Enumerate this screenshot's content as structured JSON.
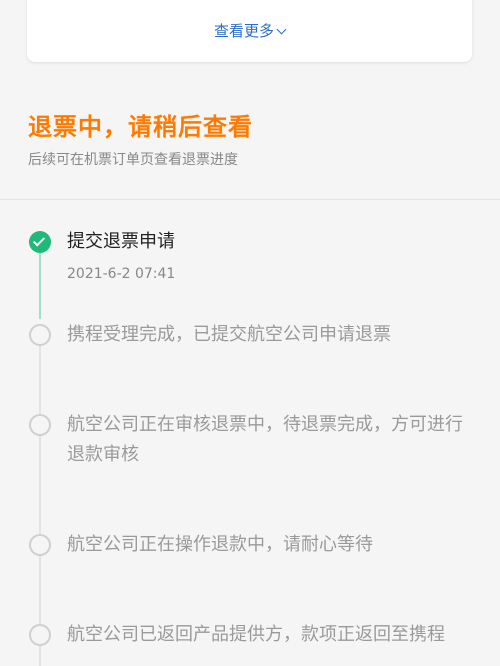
{
  "card": {
    "see_more_label": "查看更多"
  },
  "status": {
    "title": "退票中，请稍后查看",
    "subtitle": "后续可在机票订单页查看退票进度"
  },
  "steps": [
    {
      "text": "提交退票申请",
      "time": "2021-6-2 07:41",
      "done": true
    },
    {
      "text": "携程受理完成，已提交航空公司申请退票",
      "done": false
    },
    {
      "text": "航空公司正在审核退票中，待退票完成，方可进行退款审核",
      "done": false
    },
    {
      "text": "航空公司正在操作退款中，请耐心等待",
      "done": false
    },
    {
      "text": "航空公司已返回产品提供方，款项正返回至携程",
      "done": false
    }
  ],
  "colors": {
    "accent_orange": "#ff7a00",
    "link_blue": "#2a6ec8",
    "success_green": "#1fb97a"
  }
}
